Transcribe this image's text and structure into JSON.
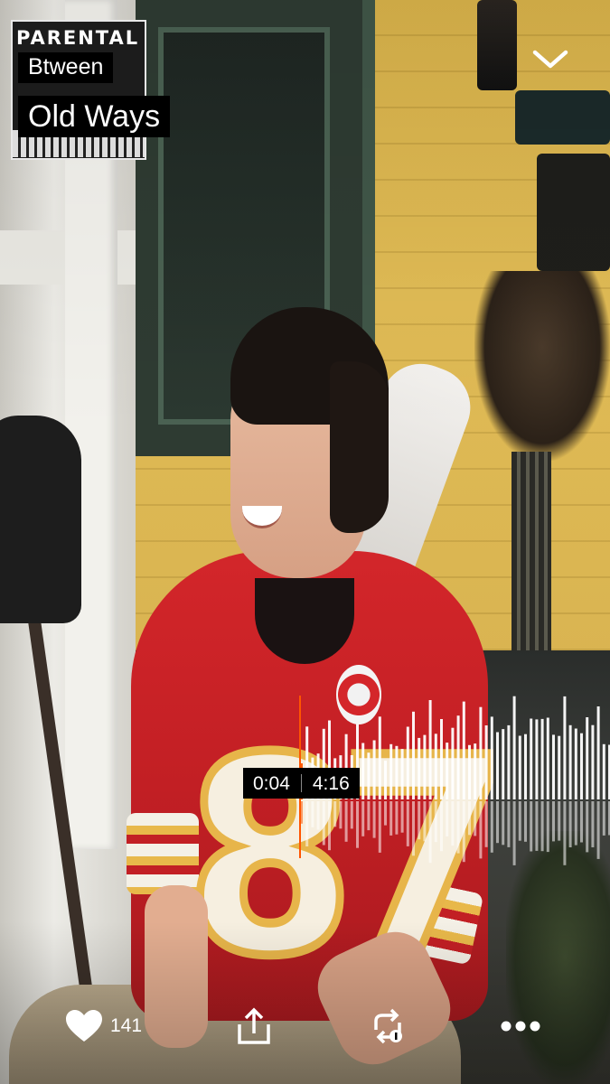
{
  "track": {
    "artist": "Btween",
    "title": "Old Ways",
    "album_art_text": "PARENTAL ADVISORY"
  },
  "player": {
    "current_time": "0:04",
    "duration": "4:16",
    "progress": 0.016
  },
  "actions": {
    "like_count": "141"
  },
  "icons": {
    "minimize": "chevron-down-icon",
    "like": "heart-icon",
    "share": "share-icon",
    "repost": "repost-icon",
    "more": "more-icon"
  },
  "colors": {
    "played": "#ff5500",
    "waveform": "#ffffff",
    "label_bg": "#000000"
  }
}
